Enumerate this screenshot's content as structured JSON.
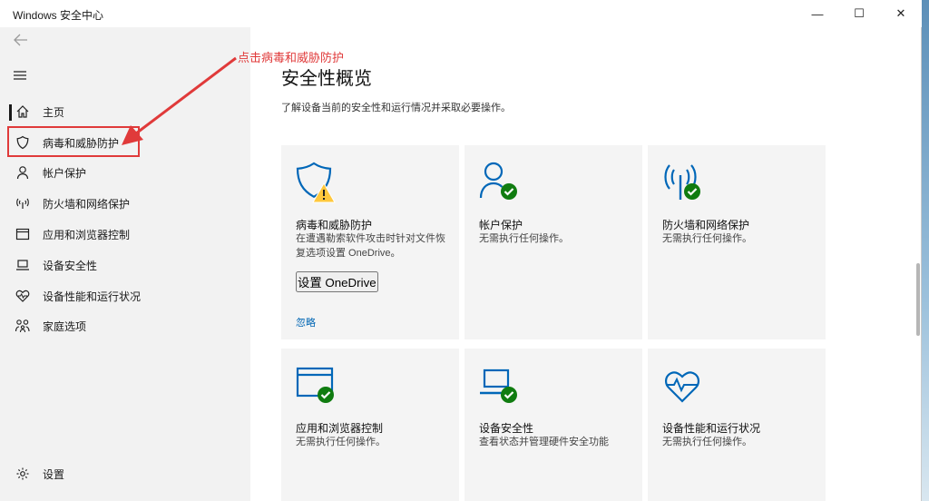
{
  "window": {
    "title": "Windows 安全中心",
    "controls": {
      "minimize": "—",
      "maximize": "☐",
      "close": "✕"
    }
  },
  "annotation": {
    "text": "点击病毒和威胁防护",
    "color": "#e03a3a"
  },
  "sidebar": {
    "items": [
      {
        "label": "主页",
        "icon": "home-icon"
      },
      {
        "label": "病毒和威胁防护",
        "icon": "shield-icon"
      },
      {
        "label": "帐户保护",
        "icon": "person-icon"
      },
      {
        "label": "防火墙和网络保护",
        "icon": "wifi-icon"
      },
      {
        "label": "应用和浏览器控制",
        "icon": "browser-window-icon"
      },
      {
        "label": "设备安全性",
        "icon": "laptop-icon"
      },
      {
        "label": "设备性能和运行状况",
        "icon": "heart-icon"
      },
      {
        "label": "家庭选项",
        "icon": "family-icon"
      }
    ],
    "settings_label": "设置",
    "selected": "主页"
  },
  "main": {
    "title": "安全性概览",
    "subtitle": "了解设备当前的安全性和运行情况并采取必要操作。",
    "cards": [
      {
        "title": "病毒和威胁防护",
        "desc": "在遭遇勒索软件攻击时针对文件恢复选项设置 OneDrive。",
        "status": "warning",
        "button": "设置 OneDrive",
        "link": "忽略"
      },
      {
        "title": "帐户保护",
        "desc": "无需执行任何操作。",
        "status": "ok"
      },
      {
        "title": "防火墙和网络保护",
        "desc": "无需执行任何操作。",
        "status": "ok"
      },
      {
        "title": "应用和浏览器控制",
        "desc": "无需执行任何操作。",
        "status": "ok"
      },
      {
        "title": "设备安全性",
        "desc": "查看状态并管理硬件安全功能",
        "status": "ok"
      },
      {
        "title": "设备性能和运行状况",
        "desc": "无需执行任何操作。",
        "status": "ok"
      }
    ]
  },
  "colors": {
    "accent_blue": "#0067b8",
    "ok_green": "#107c10",
    "warning_yellow": "#ffc83d",
    "annotation_red": "#e03a3a"
  }
}
